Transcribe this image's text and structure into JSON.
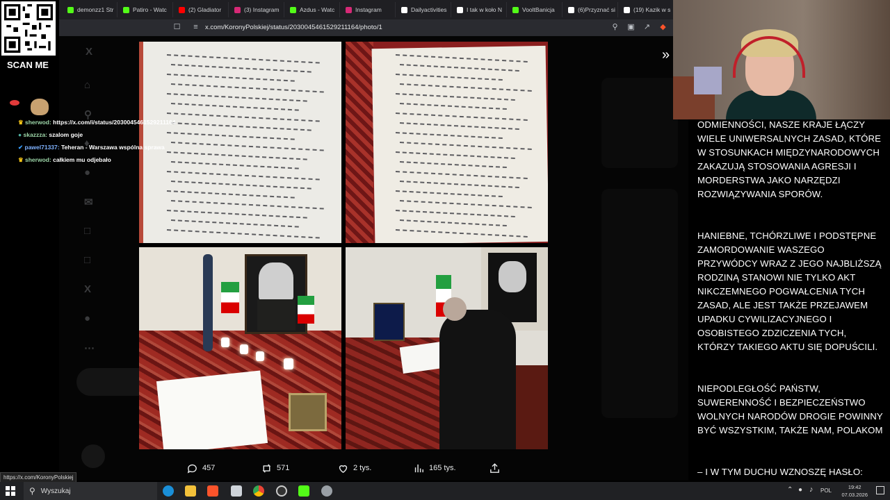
{
  "browser": {
    "tabs": [
      {
        "label": "demonzz1 Str",
        "color": "#53fc18"
      },
      {
        "label": "Patiro - Watc",
        "color": "#53fc18"
      },
      {
        "label": "(2) Gladiator",
        "color": "#ff0000"
      },
      {
        "label": "(3) Instagram",
        "color": "#d62976"
      },
      {
        "label": "Azdus - Watc",
        "color": "#53fc18"
      },
      {
        "label": "Instagram",
        "color": "#d62976"
      },
      {
        "label": "Dailyactivities",
        "color": "#ffffff"
      },
      {
        "label": "I tak w koło N",
        "color": "#ffffff"
      },
      {
        "label": "VooltBanicja",
        "color": "#53fc18"
      },
      {
        "label": "(6)Przyznać si",
        "color": "#ffffff"
      },
      {
        "label": "(19) Kazik w s",
        "color": "#ffffff"
      }
    ],
    "url": "x.com/KoronyPolskiej/status/2030045461529211164/photo/1",
    "status_url": "https://x.com/KoronyPolskiej"
  },
  "overlay": {
    "scan_label": "SCAN ME",
    "chat": [
      {
        "user": "sherwod:",
        "message": "https://x.com/i/status/2030045461529211164"
      },
      {
        "user": "skazzza:",
        "message": "szalom goje"
      },
      {
        "user": "pawel71337:",
        "message": "Teheran - Warszawa wspólna sprawa"
      },
      {
        "user": "sherwod:",
        "message": "całkiem mu odjebało"
      }
    ]
  },
  "post_actions": {
    "replies": "457",
    "reposts": "571",
    "likes": "2 tys.",
    "views": "165 tys."
  },
  "transcript": [
    "ODMIENNOŚCI, NASZE KRAJE ŁĄCZY WIELE UNIWERSALNYCH ZASAD, KTÓRE W STOSUNKACH MIĘDZYNARODOWYCH ZAKAZUJĄ STOSOWANIA AGRESJI I MORDERSTWA JAKO NARZĘDZI ROZWIĄZYWANIA SPORÓW.",
    "HANIEBNE, TCHÓRZLIWE I PODSTĘPNE ZAMORDOWANIE WASZEGO PRZYWÓDCY WRAZ Z JEGO NAJBLIŻSZĄ RODZINĄ STANOWI NIE TYLKO AKT NIKCZEMNEGO POGWAŁCENIA TYCH ZASAD, ALE JEST TAKŻE PRZEJAWEM UPADKU CYWILIZACYJNEGO I OSOBISTEGO ZDZICZENIA TYCH, KTÓRZY TAKIEGO AKTU SIĘ DOPUŚCILI.",
    "NIEPODLEGŁOŚĆ PAŃSTW, SUWERENNOŚĆ I BEZPIECZEŃSTWO WOLNYCH NARODÓW DROGIE POWINNY BYĆ WSZYSTKIM, TAKŻE NAM, POLAKOM",
    "– I W TYM DUCHU WZNOSZĘ HASŁO:"
  ],
  "taskbar": {
    "search_placeholder": "Wyszukaj",
    "lang": "POL",
    "time": "19:42",
    "date": "07.03.2026"
  }
}
